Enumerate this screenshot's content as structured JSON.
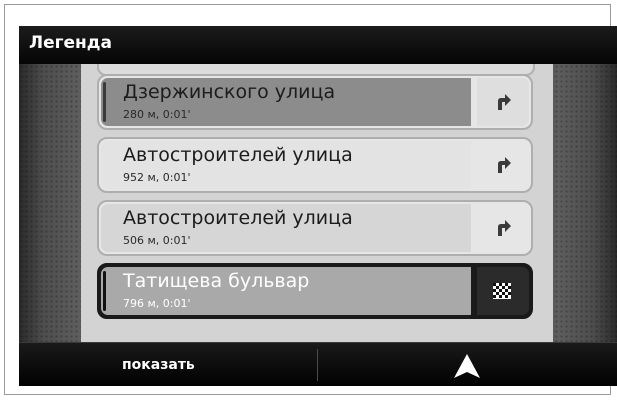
{
  "window": {
    "title": "Легенда"
  },
  "route": {
    "items": [
      {
        "street": "Дзержинского улица",
        "meta": "280 м, 0:01'",
        "icon": "turn-right-icon"
      },
      {
        "street": "Автостроителей улица",
        "meta": "952 м, 0:01'",
        "icon": "turn-right-icon"
      },
      {
        "street": "Автостроителей улица",
        "meta": "506 м, 0:01'",
        "icon": "turn-right-icon"
      },
      {
        "street": "Татищева бульвар",
        "meta": "796 м, 0:01'",
        "icon": "finish-flag-icon"
      }
    ]
  },
  "bottombar": {
    "show_label": "показать",
    "nav_icon": "navigation-arrow-icon"
  },
  "colors": {
    "bar": "#0a0a0a",
    "list_bg": "#d3d3d3",
    "row_dark": "#8c8c8c",
    "selected": "#1a1a1a"
  }
}
